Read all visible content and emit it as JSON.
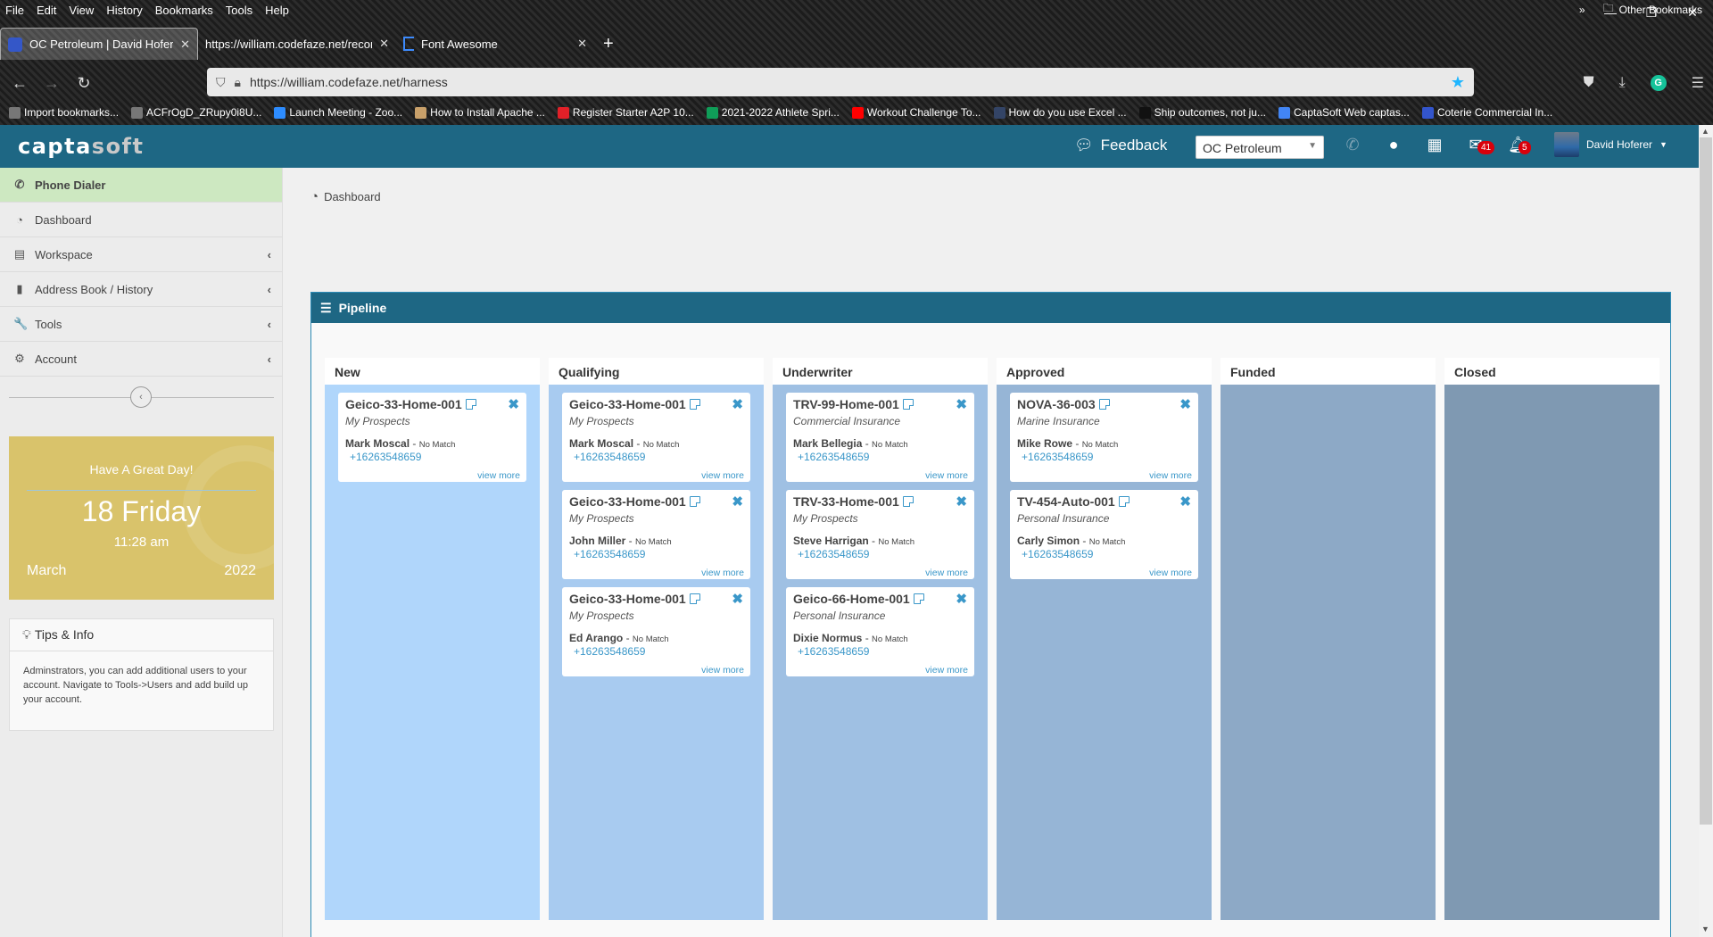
{
  "browser": {
    "menu": [
      "File",
      "Edit",
      "View",
      "History",
      "Bookmarks",
      "Tools",
      "Help"
    ],
    "window_controls": {
      "minimize": "—",
      "restore": "❐",
      "close": "✕"
    },
    "tabs": [
      {
        "title": "OC Petroleum | David Hoferer",
        "active": true
      },
      {
        "title": "https://william.codefaze.net/records",
        "active": false
      },
      {
        "title": "Font Awesome",
        "active": false
      }
    ],
    "new_tab": "+",
    "url": "https://william.codefaze.net/harness",
    "bookmarks": [
      {
        "label": "Import bookmarks...",
        "color": "#777777"
      },
      {
        "label": "ACFrOgD_ZRupy0i8U...",
        "color": "#777777"
      },
      {
        "label": "Launch Meeting - Zoo...",
        "color": "#2d8cff"
      },
      {
        "label": "How to Install Apache ...",
        "color": "#c8a06a"
      },
      {
        "label": "Register Starter A2P 10...",
        "color": "#e22028"
      },
      {
        "label": "2021-2022 Athlete Spri...",
        "color": "#0f9d58"
      },
      {
        "label": "Workout Challenge To...",
        "color": "#ff0000"
      },
      {
        "label": "How do you use Excel ...",
        "color": "#334466"
      },
      {
        "label": "Ship outcomes, not ju...",
        "color": "#111111"
      },
      {
        "label": "CaptaSoft Web  captas...",
        "color": "#4285f4"
      },
      {
        "label": "Coterie Commercial In...",
        "color": "#3355cc"
      }
    ],
    "other_bookmarks": "Other Bookmarks"
  },
  "app": {
    "logo": {
      "part1": "capta",
      "part2": "soft"
    },
    "feedback": "Feedback",
    "company_select": "OC Petroleum",
    "mail_badge": "41",
    "notif_badge": "5",
    "user_name": "David Hoferer"
  },
  "sidebar": {
    "items": [
      {
        "label": "Phone Dialer",
        "icon": "phone-icon",
        "glyph": "✆",
        "active": true,
        "expandable": false
      },
      {
        "label": "Dashboard",
        "icon": "dashboard-icon",
        "glyph": "◔",
        "active": false,
        "expandable": false
      },
      {
        "label": "Workspace",
        "icon": "clipboard-icon",
        "glyph": "▤",
        "active": false,
        "expandable": true
      },
      {
        "label": "Address Book / History",
        "icon": "book-icon",
        "glyph": "▮",
        "active": false,
        "expandable": true
      },
      {
        "label": "Tools",
        "icon": "wrench-icon",
        "glyph": "🔧",
        "active": false,
        "expandable": true
      },
      {
        "label": "Account",
        "icon": "gear-icon",
        "glyph": "⚙",
        "active": false,
        "expandable": true
      }
    ],
    "day_widget": {
      "greeting": "Have A Great Day!",
      "day": "18 Friday",
      "time": "11:28 am",
      "month": "March",
      "year": "2022"
    },
    "tips": {
      "title": "Tips & Info",
      "body": "Adminstrators, you can add additional users to your account. Navigate to Tools->Users and add build up your account."
    }
  },
  "main": {
    "breadcrumb": "Dashboard",
    "pipeline_title": "Pipeline",
    "columns": [
      {
        "name": "New",
        "color": "#b0d6fb",
        "cards": [
          {
            "title": "Geico-33-Home-001",
            "category": "My Prospects",
            "contact": "Mark Moscal",
            "match": "No Match",
            "phone": "+16263548659",
            "more": "view more"
          }
        ]
      },
      {
        "name": "Qualifying",
        "color": "#a8cbf0",
        "cards": [
          {
            "title": "Geico-33-Home-001",
            "category": "My Prospects",
            "contact": "Mark Moscal",
            "match": "No Match",
            "phone": "+16263548659",
            "more": "view more"
          },
          {
            "title": "Geico-33-Home-001",
            "category": "My Prospects",
            "contact": "John Miller",
            "match": "No Match",
            "phone": "+16263548659",
            "more": "view more"
          },
          {
            "title": "Geico-33-Home-001",
            "category": "My Prospects",
            "contact": "Ed Arango",
            "match": "No Match",
            "phone": "+16263548659",
            "more": "view more"
          }
        ]
      },
      {
        "name": "Underwriter",
        "color": "#9fc0e3",
        "cards": [
          {
            "title": "TRV-99-Home-001",
            "category": "Commercial Insurance",
            "contact": "Mark Bellegia",
            "match": "No Match",
            "phone": "+16263548659",
            "more": "view more"
          },
          {
            "title": "TRV-33-Home-001",
            "category": "My Prospects",
            "contact": "Steve Harrigan",
            "match": "No Match",
            "phone": "+16263548659",
            "more": "view more"
          },
          {
            "title": "Geico-66-Home-001",
            "category": "Personal Insurance",
            "contact": "Dixie Normus",
            "match": "No Match",
            "phone": "+16263548659",
            "more": "view more"
          }
        ]
      },
      {
        "name": "Approved",
        "color": "#96b5d6",
        "cards": [
          {
            "title": "NOVA-36-003",
            "category": "Marine Insurance",
            "contact": "Mike Rowe",
            "match": "No Match",
            "phone": "+16263548659",
            "more": "view more"
          },
          {
            "title": "TV-454-Auto-001",
            "category": "Personal Insurance",
            "contact": "Carly Simon",
            "match": "No Match",
            "phone": "+16263548659",
            "more": "view more"
          }
        ]
      },
      {
        "name": "Funded",
        "color": "#8da9c6",
        "cards": []
      },
      {
        "name": "Closed",
        "color": "#7f99b2",
        "cards": []
      }
    ]
  }
}
